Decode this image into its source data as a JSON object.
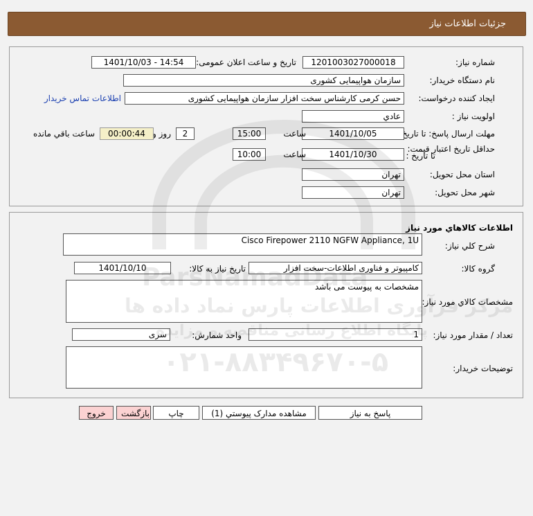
{
  "page": {
    "title": "جزئیات اطلاعات نیاز"
  },
  "need_info": {
    "need_number_label": "شماره نیاز:",
    "need_number": "1201003027000018",
    "announce_label": "تاریخ و ساعت اعلان عمومی:",
    "announce_value": "1401/10/03 - 14:54",
    "buyer_org_label": "نام دستگاه خریدار:",
    "buyer_org": "سازمان هواپیمایی کشوری",
    "creator_label": "ایجاد کننده درخواست:",
    "creator": "حسن کرمی کارشناس سخت افزار سازمان هواپیمایی کشوری",
    "contact_link": "اطلاعات تماس خریدار",
    "priority_label": "اولویت نیاز :",
    "priority": "عادي",
    "deadline_label": "مهلت ارسال پاسخ: تا تاریخ :",
    "deadline_date": "1401/10/05",
    "time_label": "ساعت",
    "deadline_time": "15:00",
    "days_value": "2",
    "days_label": "روز و",
    "remaining_time": "00:00:44",
    "remaining_label": "ساعت باقي مانده",
    "min_validity_label": "حداقل تاریخ اعتبار قیمت:",
    "to_date_label": "تا تاریخ :",
    "validity_date": "1401/10/30",
    "validity_time": "10:00",
    "province_label": "استان محل تحویل:",
    "province": "تهران",
    "city_label": "شهر محل تحویل:",
    "city": "تهران"
  },
  "goods_info": {
    "section_title": "اطلاعات کالاهاي مورد نیاز",
    "general_desc_label": "شرح کلي نیاز:",
    "general_desc": "Cisco Firepower 2110 NGFW Appliance, 1U",
    "group_label": "گروه کالا:",
    "group": "کامپیوتر و فناوری اطلاعات-سخت افزار",
    "need_date_label": "تاریخ نیاز به کالا:",
    "need_date": "1401/10/10",
    "specs_label": "مشخصات کالاي مورد نیاز:",
    "specs": "مشخصات به پیوست می باشد",
    "qty_label": "تعداد / مقدار مورد نیاز:",
    "qty": "1",
    "unit_label": "واحد شمارش:",
    "unit": "سری",
    "buyer_notes_label": "توضیحات خریدار:",
    "buyer_notes": ""
  },
  "buttons": {
    "reply": "پاسخ به نیاز",
    "attachments": "مشاهده مدارک پیوستي (1)",
    "print": "چاپ",
    "back": "بازگشت",
    "exit": "خروج"
  },
  "watermark": {
    "brand": "ParsNamadData",
    "line1": "مرکز فرآوری اطلاعات پارس نماد داده ها",
    "line2": "پایگاه اطلاع رسانی مناقصه و مزایده",
    "phone": "۰۲۱-۸۸۳۴۹۶۷۰-۵"
  },
  "colors": {
    "title_bar": "#8b5a32",
    "link": "#1a3fb0",
    "timer_bg": "#f5f0c8",
    "pink_button": "#fbd2d2"
  }
}
